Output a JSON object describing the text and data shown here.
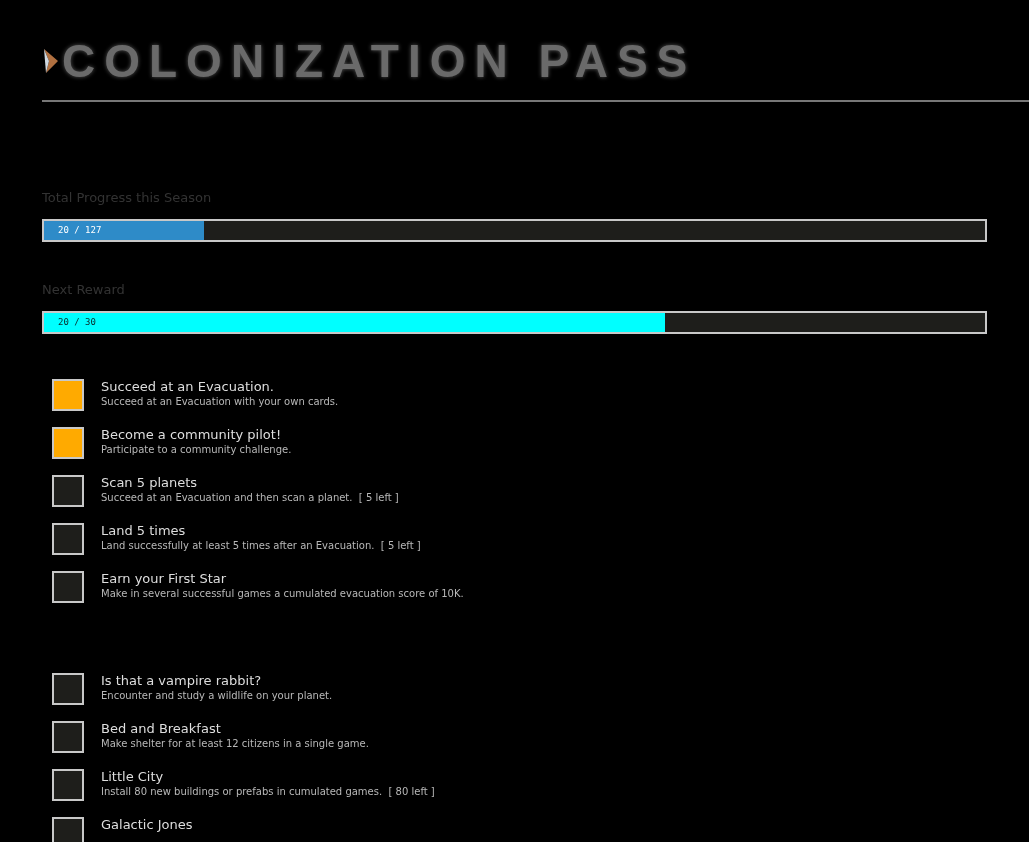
{
  "header": {
    "title": "COLONIZATION PASS"
  },
  "progress": [
    {
      "label": "Total Progress this Season",
      "reading": "20 / 127",
      "level": 0.17,
      "kind": "season"
    },
    {
      "label": "Next Reward",
      "reading": "20 / 30",
      "level": 0.66,
      "kind": "reward"
    }
  ],
  "groups": [
    {
      "items": [
        {
          "title": "Succeed at an Evacuation.",
          "description": "Succeed at an Evacuation with your own cards.",
          "checked": true
        },
        {
          "title": "Become a community pilot!",
          "description": "Participate to a community challenge.",
          "checked": true
        },
        {
          "title": "Scan 5 planets",
          "description": "Succeed at an Evacuation and then scan a planet.  [ 5 left ]",
          "checked": false
        },
        {
          "title": "Land 5 times",
          "description": "Land successfully at least 5 times after an Evacuation.  [ 5 left ]",
          "checked": false
        },
        {
          "title": "Earn your First Star",
          "description": "Make in several successful games a cumulated evacuation score of 10K.",
          "checked": false
        }
      ]
    },
    {
      "items": [
        {
          "title": "Is that a vampire rabbit?",
          "description": "Encounter and study a wildlife on your planet.",
          "checked": false
        },
        {
          "title": "Bed and Breakfast",
          "description": "Make shelter for at least 12 citizens in a single game.",
          "checked": false
        },
        {
          "title": "Little City",
          "description": "Install 80 new buildings or prefabs in cumulated games.  [ 80 left ]",
          "checked": false
        },
        {
          "title": "Galactic Jones",
          "checked": false
        }
      ]
    }
  ]
}
